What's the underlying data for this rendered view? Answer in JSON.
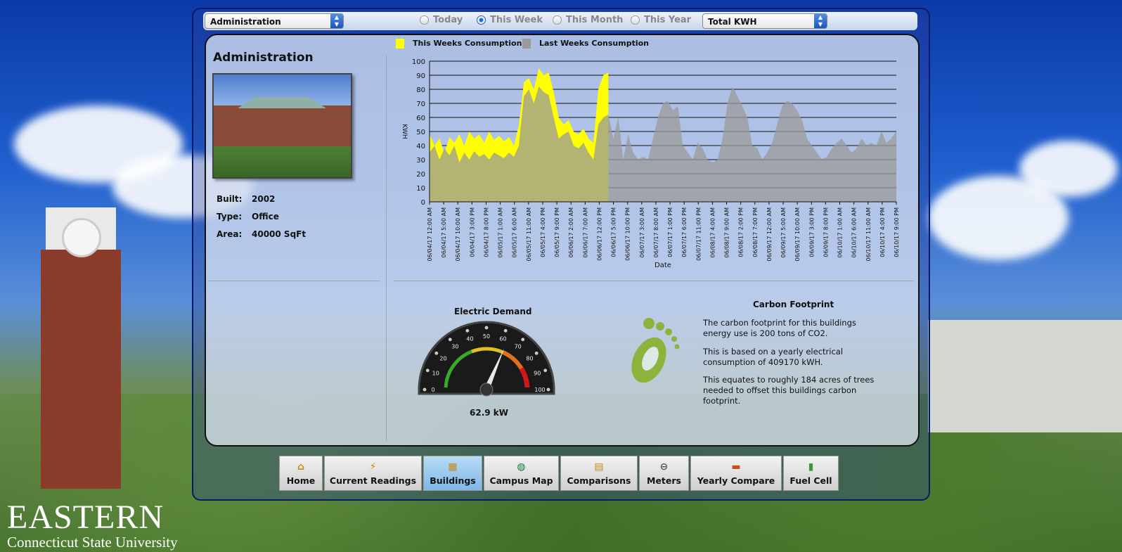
{
  "topbar": {
    "building_select": "Administration",
    "range_options": [
      {
        "label": "Today",
        "selected": false
      },
      {
        "label": "This Week",
        "selected": true
      },
      {
        "label": "This Month",
        "selected": false
      },
      {
        "label": "This Year",
        "selected": false
      }
    ],
    "metric_select": "Total KWH"
  },
  "building": {
    "name": "Administration",
    "built_label": "Built:",
    "built": "2002",
    "type_label": "Type:",
    "type": "Office",
    "area_label": "Area:",
    "area": "40000 SqFt"
  },
  "chart_data": {
    "type": "area",
    "xlabel": "Date",
    "ylabel": "KWH",
    "ylim": [
      0,
      100
    ],
    "yticks": [
      0,
      10,
      20,
      30,
      40,
      50,
      60,
      70,
      80,
      90,
      100
    ],
    "grid": true,
    "legend_placement": "top-left",
    "x_tick_labels": [
      "06/04/17 12:00 AM",
      "06/04/17 5:00 AM",
      "06/04/17 10:00 AM",
      "06/04/17 3:00 PM",
      "06/04/17 8:00 PM",
      "06/05/17 1:00 AM",
      "06/05/17 6:00 AM",
      "06/05/17 11:00 AM",
      "06/05/17 4:00 PM",
      "06/05/17 9:00 PM",
      "06/06/17 2:00 AM",
      "06/06/17 7:00 AM",
      "06/06/17 12:00 PM",
      "06/06/17 5:00 PM",
      "06/06/17 10:00 PM",
      "06/07/17 3:00 AM",
      "06/07/17 8:00 AM",
      "06/07/17 1:00 PM",
      "06/07/17 6:00 PM",
      "06/07/17 11:00 PM",
      "06/08/17 4:00 AM",
      "06/08/17 9:00 AM",
      "06/08/17 2:00 PM",
      "06/08/17 7:00 PM",
      "06/09/17 12:00 AM",
      "06/09/17 5:00 AM",
      "06/09/17 10:00 AM",
      "06/09/17 3:00 PM",
      "06/09/17 8:00 PM",
      "06/10/17 1:00 AM",
      "06/10/17 6:00 AM",
      "06/10/17 11:00 AM",
      "06/10/17 4:00 PM",
      "06/10/17 9:00 PM"
    ],
    "series": [
      {
        "name": "This Weeks Consumption",
        "color": "#ffff00",
        "values": [
          48,
          40,
          45,
          35,
          46,
          42,
          48,
          40,
          50,
          45,
          48,
          42,
          50,
          44,
          47,
          43,
          46,
          40,
          55,
          85,
          88,
          80,
          95,
          90,
          92,
          78,
          60,
          55,
          58,
          50,
          48,
          52,
          45,
          42,
          80,
          90,
          92
        ]
      },
      {
        "name": "Last Weeks Consumption",
        "color": "#9a9a9a",
        "values": [
          35,
          40,
          30,
          38,
          33,
          40,
          28,
          35,
          30,
          36,
          32,
          34,
          30,
          35,
          33,
          31,
          35,
          32,
          40,
          75,
          80,
          70,
          82,
          78,
          76,
          60,
          45,
          48,
          50,
          40,
          38,
          42,
          35,
          30,
          55,
          60,
          62,
          45,
          60,
          30,
          48,
          35,
          30,
          32,
          30,
          45,
          60,
          70,
          72,
          65,
          68,
          40,
          35,
          30,
          42,
          38,
          30,
          28,
          30,
          45,
          70,
          82,
          75,
          68,
          60,
          40,
          38,
          30,
          35,
          42,
          55,
          68,
          72,
          70,
          65,
          58,
          45,
          40,
          35,
          30,
          32,
          38,
          42,
          45,
          40,
          35,
          38,
          45,
          40,
          42,
          40,
          50,
          42,
          45,
          50
        ]
      }
    ]
  },
  "demand": {
    "title": "Electric Demand",
    "value_text": "62.9 kW",
    "value": 62.9,
    "scale": [
      "0",
      "10",
      "20",
      "30",
      "40",
      "50",
      "60",
      "70",
      "80",
      "90",
      "100"
    ]
  },
  "carbon": {
    "title": "Carbon Footprint",
    "p1": "The carbon footprint for this buildings energy use is 200 tons of CO2.",
    "p2": "This is based on a yearly electrical consumption of 409170 kWH.",
    "p3": "This equates to roughly 184 acres of trees needed to offset this buildings carbon footprint."
  },
  "nav": [
    {
      "label": "Home",
      "icon": "home-icon"
    },
    {
      "label": "Current Readings",
      "icon": "lightning-icon"
    },
    {
      "label": "Buildings",
      "icon": "building-icon"
    },
    {
      "label": "Campus Map",
      "icon": "globe-icon"
    },
    {
      "label": "Comparisons",
      "icon": "compare-icon"
    },
    {
      "label": "Meters",
      "icon": "meter-icon"
    },
    {
      "label": "Yearly Compare",
      "icon": "bar-chart-icon"
    },
    {
      "label": "Fuel Cell",
      "icon": "battery-icon"
    }
  ],
  "branding": {
    "line1": "EASTERN",
    "line2": "Connecticut State University"
  }
}
